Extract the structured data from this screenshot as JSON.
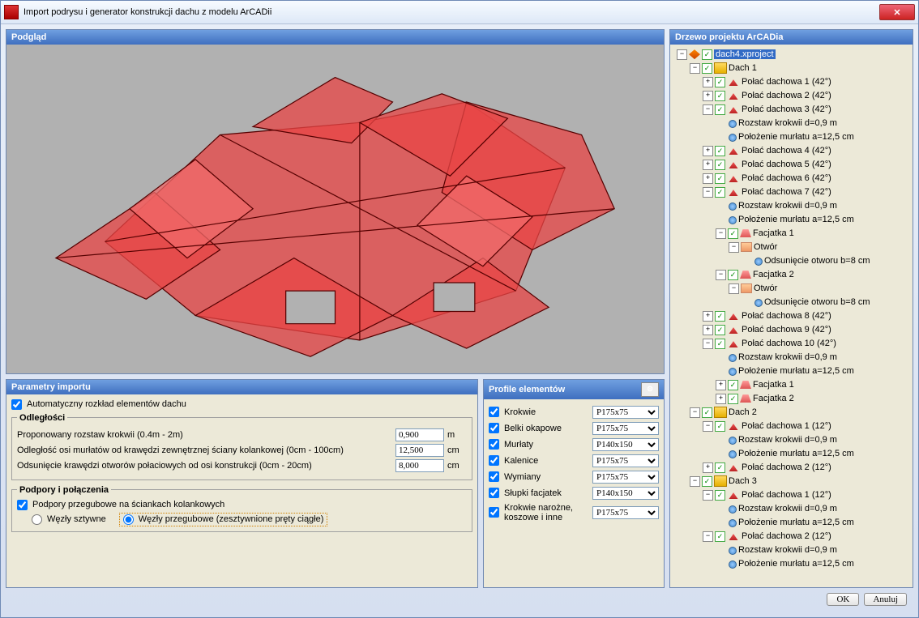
{
  "window": {
    "title": "Import podrysu i generator konstrukcji dachu z modelu ArCADii"
  },
  "panels": {
    "preview": "Podgląd",
    "params": "Parametry importu",
    "profiles": "Profile elementów",
    "tree": "Drzewo projektu ArCADia"
  },
  "params": {
    "auto": "Automatyczny rozkład elementów dachu",
    "legend_dist": "Odległości",
    "r1_lbl": "Proponowany rozstaw krokwii (0.4m - 2m)",
    "r1_val": "0,900",
    "r1_unit": "m",
    "r2_lbl": "Odległość osi murłatów od krawędzi zewnętrznej ściany kolankowej (0cm - 100cm)",
    "r2_val": "12,500",
    "r2_unit": "cm",
    "r3_lbl": "Odsunięcie krawędzi otworów połaciowych od osi konstrukcji (0cm - 20cm)",
    "r3_val": "8,000",
    "r3_unit": "cm",
    "legend_supp": "Podpory i połączenia",
    "supp_chk": "Podpory przegubowe na ściankach kolankowych",
    "rad1": "Węzły sztywne",
    "rad2": "Węzły przegubowe (zesztywnione pręty ciągłe)"
  },
  "profiles": [
    {
      "lbl": "Krokwie",
      "val": "P175x75"
    },
    {
      "lbl": "Belki okapowe",
      "val": "P175x75"
    },
    {
      "lbl": "Murłaty",
      "val": "P140x150"
    },
    {
      "lbl": "Kalenice",
      "val": "P175x75"
    },
    {
      "lbl": "Wymiany",
      "val": "P175x75"
    },
    {
      "lbl": "Słupki facjatek",
      "val": "P140x150"
    },
    {
      "lbl": "Krokwie narożne, koszowe i inne",
      "val": "P175x75"
    }
  ],
  "tree_labels": {
    "project": "dach4.xproject",
    "dach1": "Dach 1",
    "dach2": "Dach 2",
    "dach3": "Dach 3",
    "pol1": "Połać dachowa 1 (42°)",
    "pol2": "Połać dachowa 2 (42°)",
    "pol3": "Połać dachowa 3 (42°)",
    "pol4": "Połać dachowa 4 (42°)",
    "pol5": "Połać dachowa 5 (42°)",
    "pol6": "Połać dachowa 6 (42°)",
    "pol7": "Połać dachowa 7 (42°)",
    "pol8": "Połać dachowa 8 (42°)",
    "pol9": "Połać dachowa 9 (42°)",
    "pol10": "Połać dachowa 10 (42°)",
    "d2p1": "Połać dachowa 1 (12°)",
    "d2p2": "Połać dachowa 2 (12°)",
    "d3p1": "Połać dachowa 1 (12°)",
    "d3p2": "Połać dachowa 2 (12°)",
    "rozstaw": "Rozstaw krokwii d=0,9 m",
    "polozenie": "Położenie murłatu a=12,5 cm",
    "fac1": "Facjatka 1",
    "fac2": "Facjatka 2",
    "otwor": "Otwór",
    "odsun": "Odsunięcie otworu b=8 cm"
  },
  "buttons": {
    "ok": "OK",
    "cancel": "Anuluj"
  }
}
